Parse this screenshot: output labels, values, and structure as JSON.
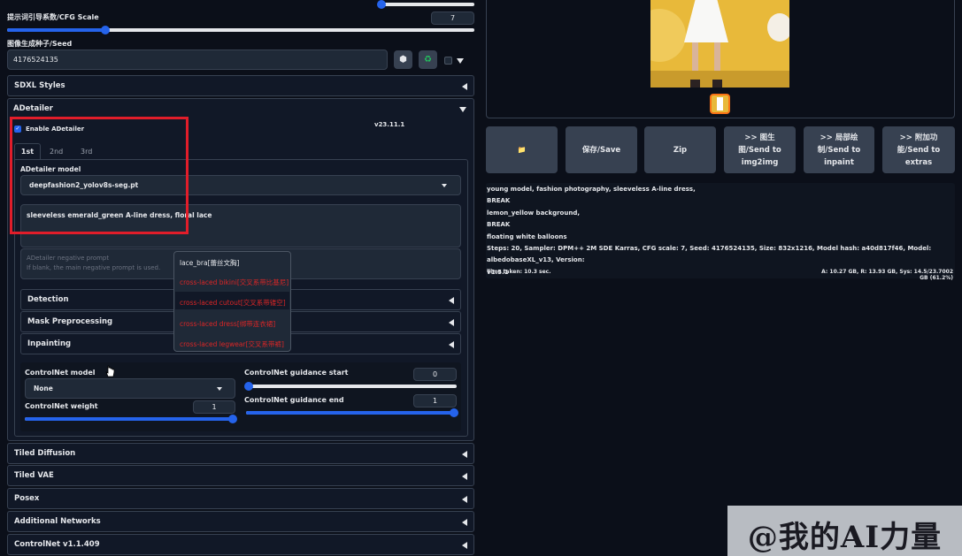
{
  "cfg": {
    "label": "提示词引导系数/CFG Scale",
    "value": "7",
    "fill_percent": 21
  },
  "seed": {
    "label": "图像生成种子/Seed",
    "value": "4176524135"
  },
  "sdxl_styles": {
    "title": "SDXL Styles"
  },
  "adetailer": {
    "title": "ADetailer",
    "enable_label": "Enable ADetailer",
    "version": "v23.11.1",
    "tabs": [
      "1st",
      "2nd",
      "3rd"
    ],
    "model_label": "ADetailer model",
    "model_value": "deepfashion2_yolov8s-seg.pt",
    "prompt": "sleeveless emerald_green A-line dress, floral lace",
    "neg_label": "ADetailer negative prompt",
    "neg_placeholder": "If blank, the main negative prompt is used.",
    "detection": "Detection",
    "mask": "Mask Preprocessing",
    "inpainting": "Inpainting",
    "cn_model_label": "ControlNet model",
    "cn_model_value": "None",
    "cn_weight_label": "ControlNet weight",
    "cn_weight_value": "1",
    "cn_start_label": "ControlNet guidance start",
    "cn_start_value": "0",
    "cn_end_label": "ControlNet guidance end",
    "cn_end_value": "1"
  },
  "autocomplete": {
    "first": "lace_bra[蕾丝文胸]",
    "items": [
      "cross-laced bikini[交叉系带比基尼]",
      "cross-laced cutout[交叉系带镂空]",
      "cross-laced dress[绑带连衣裙]",
      "cross-laced legwear[交叉系带裤]"
    ]
  },
  "panels": [
    "Tiled Diffusion",
    "Tiled VAE",
    "Posex",
    "Additional Networks",
    "ControlNet v1.1.409"
  ],
  "actions": {
    "folder": "📁",
    "save": "保存/Save",
    "zip": "Zip",
    "img2img": ">> 图生图/Send to img2img",
    "inpaint": ">> 局部绘制/Send to inpaint",
    "extras": ">> 附加功能/Send to extras"
  },
  "info_lines": [
    "young model, fashion photography, sleeveless A-line dress,",
    "BREAK",
    "lemon_yellow background,",
    "BREAK",
    "floating white balloons",
    "Steps: 20, Sampler: DPM++ 2M SDE Karras, CFG scale: 7, Seed: 4176524135, Size: 832x1216, Model hash: a40d817f46, Model: albedobaseXL_v13, Version:",
    "v1.5.1"
  ],
  "time_taken": "Time taken: 10.3 sec.",
  "vram": "A: 10.27 GB, R: 13.93 GB, Sys: 14.5/23.7002 GB (61.2%)",
  "watermark": "@我的AI力量",
  "colors": {
    "accent": "#2563eb",
    "highlight_box": "#e11d2a",
    "background": "#0b0f19",
    "image_bg": "#e8b93a"
  }
}
